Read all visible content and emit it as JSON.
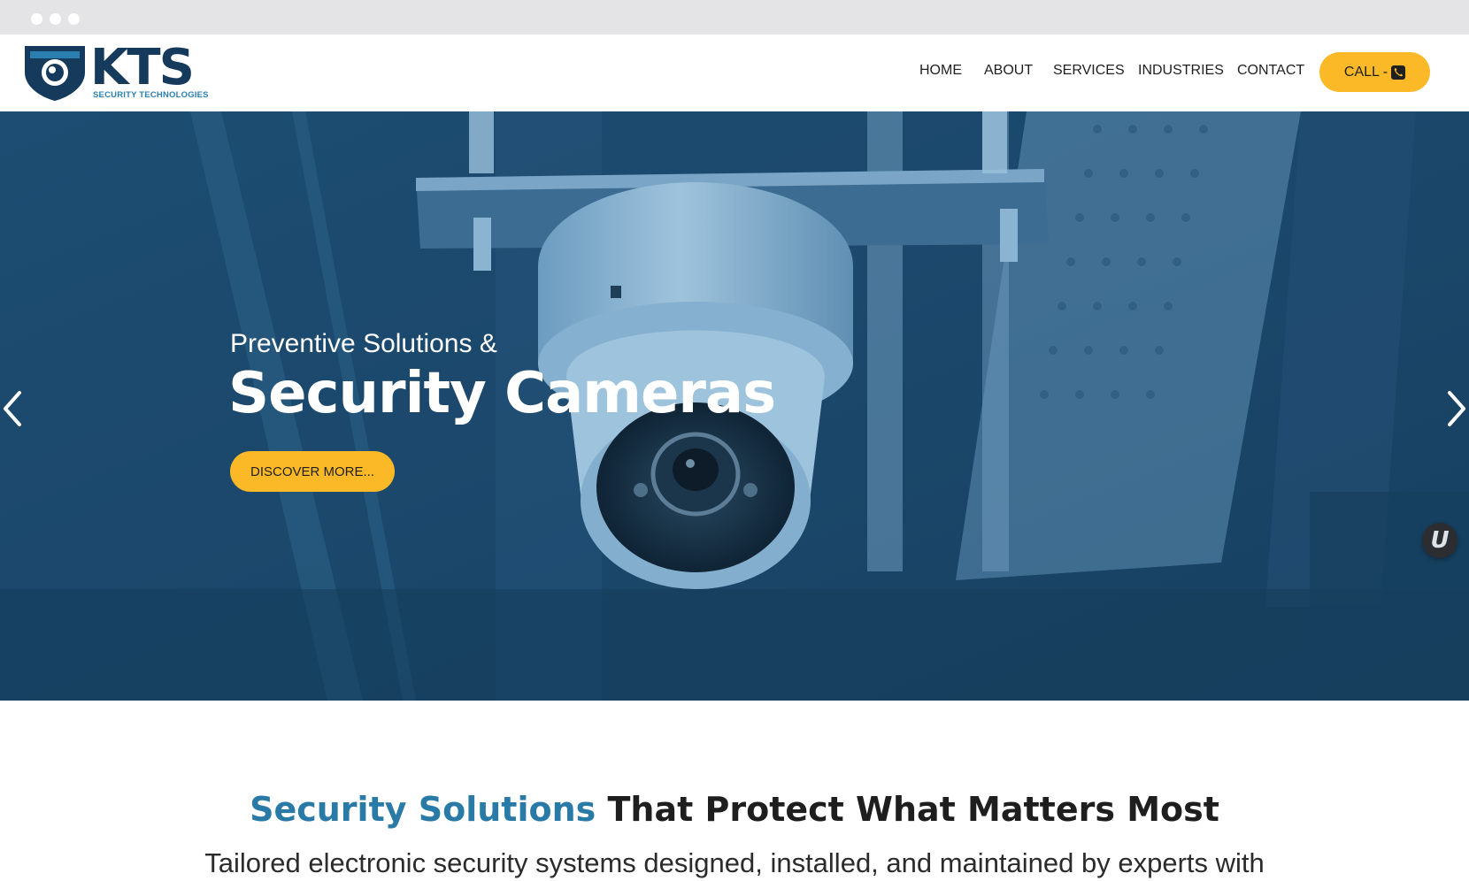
{
  "brand": {
    "name": "KTS",
    "tagline": "SECURITY TECHNOLOGIES"
  },
  "nav": {
    "items": [
      {
        "label": "HOME"
      },
      {
        "label": "ABOUT"
      },
      {
        "label": "SERVICES"
      },
      {
        "label": "INDUSTRIES"
      },
      {
        "label": "CONTACT"
      }
    ],
    "call_label": "CALL -",
    "call_icon": "phone-icon"
  },
  "hero": {
    "subtitle": "Preventive Solutions &",
    "title": "Security Cameras",
    "cta_label": "DISCOVER MORE...",
    "prev_icon": "chevron-left-icon",
    "next_icon": "chevron-right-icon",
    "badge_label": "U"
  },
  "section": {
    "heading_accent": "Security Solutions",
    "heading_rest": " That Protect What Matters Most",
    "text": "Tailored electronic security systems designed, installed, and maintained by experts with"
  },
  "colors": {
    "accent_yellow": "#fbb927",
    "brand_navy": "#163a5c",
    "brand_blue": "#2a7aa8",
    "hero_overlay": "#1b4a6e"
  }
}
